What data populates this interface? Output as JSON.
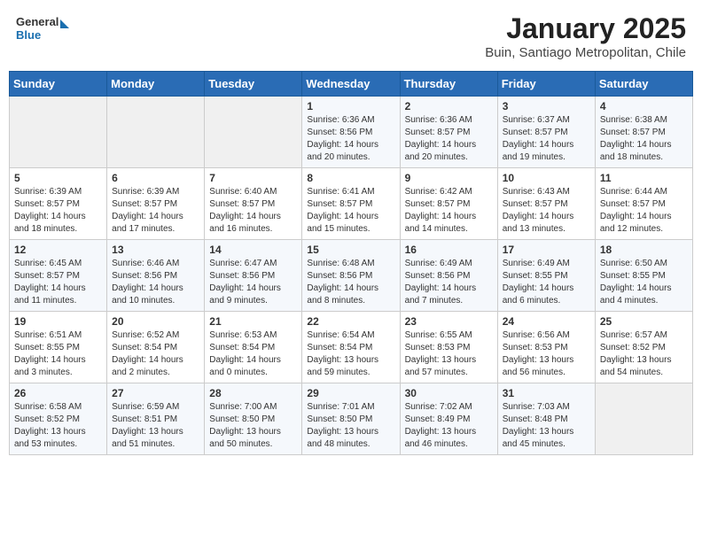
{
  "header": {
    "logo_general": "General",
    "logo_blue": "Blue",
    "month_title": "January 2025",
    "location": "Buin, Santiago Metropolitan, Chile"
  },
  "weekdays": [
    "Sunday",
    "Monday",
    "Tuesday",
    "Wednesday",
    "Thursday",
    "Friday",
    "Saturday"
  ],
  "weeks": [
    [
      {
        "day": "",
        "info": ""
      },
      {
        "day": "",
        "info": ""
      },
      {
        "day": "",
        "info": ""
      },
      {
        "day": "1",
        "info": "Sunrise: 6:36 AM\nSunset: 8:56 PM\nDaylight: 14 hours\nand 20 minutes."
      },
      {
        "day": "2",
        "info": "Sunrise: 6:36 AM\nSunset: 8:57 PM\nDaylight: 14 hours\nand 20 minutes."
      },
      {
        "day": "3",
        "info": "Sunrise: 6:37 AM\nSunset: 8:57 PM\nDaylight: 14 hours\nand 19 minutes."
      },
      {
        "day": "4",
        "info": "Sunrise: 6:38 AM\nSunset: 8:57 PM\nDaylight: 14 hours\nand 18 minutes."
      }
    ],
    [
      {
        "day": "5",
        "info": "Sunrise: 6:39 AM\nSunset: 8:57 PM\nDaylight: 14 hours\nand 18 minutes."
      },
      {
        "day": "6",
        "info": "Sunrise: 6:39 AM\nSunset: 8:57 PM\nDaylight: 14 hours\nand 17 minutes."
      },
      {
        "day": "7",
        "info": "Sunrise: 6:40 AM\nSunset: 8:57 PM\nDaylight: 14 hours\nand 16 minutes."
      },
      {
        "day": "8",
        "info": "Sunrise: 6:41 AM\nSunset: 8:57 PM\nDaylight: 14 hours\nand 15 minutes."
      },
      {
        "day": "9",
        "info": "Sunrise: 6:42 AM\nSunset: 8:57 PM\nDaylight: 14 hours\nand 14 minutes."
      },
      {
        "day": "10",
        "info": "Sunrise: 6:43 AM\nSunset: 8:57 PM\nDaylight: 14 hours\nand 13 minutes."
      },
      {
        "day": "11",
        "info": "Sunrise: 6:44 AM\nSunset: 8:57 PM\nDaylight: 14 hours\nand 12 minutes."
      }
    ],
    [
      {
        "day": "12",
        "info": "Sunrise: 6:45 AM\nSunset: 8:57 PM\nDaylight: 14 hours\nand 11 minutes."
      },
      {
        "day": "13",
        "info": "Sunrise: 6:46 AM\nSunset: 8:56 PM\nDaylight: 14 hours\nand 10 minutes."
      },
      {
        "day": "14",
        "info": "Sunrise: 6:47 AM\nSunset: 8:56 PM\nDaylight: 14 hours\nand 9 minutes."
      },
      {
        "day": "15",
        "info": "Sunrise: 6:48 AM\nSunset: 8:56 PM\nDaylight: 14 hours\nand 8 minutes."
      },
      {
        "day": "16",
        "info": "Sunrise: 6:49 AM\nSunset: 8:56 PM\nDaylight: 14 hours\nand 7 minutes."
      },
      {
        "day": "17",
        "info": "Sunrise: 6:49 AM\nSunset: 8:55 PM\nDaylight: 14 hours\nand 6 minutes."
      },
      {
        "day": "18",
        "info": "Sunrise: 6:50 AM\nSunset: 8:55 PM\nDaylight: 14 hours\nand 4 minutes."
      }
    ],
    [
      {
        "day": "19",
        "info": "Sunrise: 6:51 AM\nSunset: 8:55 PM\nDaylight: 14 hours\nand 3 minutes."
      },
      {
        "day": "20",
        "info": "Sunrise: 6:52 AM\nSunset: 8:54 PM\nDaylight: 14 hours\nand 2 minutes."
      },
      {
        "day": "21",
        "info": "Sunrise: 6:53 AM\nSunset: 8:54 PM\nDaylight: 14 hours\nand 0 minutes."
      },
      {
        "day": "22",
        "info": "Sunrise: 6:54 AM\nSunset: 8:54 PM\nDaylight: 13 hours\nand 59 minutes."
      },
      {
        "day": "23",
        "info": "Sunrise: 6:55 AM\nSunset: 8:53 PM\nDaylight: 13 hours\nand 57 minutes."
      },
      {
        "day": "24",
        "info": "Sunrise: 6:56 AM\nSunset: 8:53 PM\nDaylight: 13 hours\nand 56 minutes."
      },
      {
        "day": "25",
        "info": "Sunrise: 6:57 AM\nSunset: 8:52 PM\nDaylight: 13 hours\nand 54 minutes."
      }
    ],
    [
      {
        "day": "26",
        "info": "Sunrise: 6:58 AM\nSunset: 8:52 PM\nDaylight: 13 hours\nand 53 minutes."
      },
      {
        "day": "27",
        "info": "Sunrise: 6:59 AM\nSunset: 8:51 PM\nDaylight: 13 hours\nand 51 minutes."
      },
      {
        "day": "28",
        "info": "Sunrise: 7:00 AM\nSunset: 8:50 PM\nDaylight: 13 hours\nand 50 minutes."
      },
      {
        "day": "29",
        "info": "Sunrise: 7:01 AM\nSunset: 8:50 PM\nDaylight: 13 hours\nand 48 minutes."
      },
      {
        "day": "30",
        "info": "Sunrise: 7:02 AM\nSunset: 8:49 PM\nDaylight: 13 hours\nand 46 minutes."
      },
      {
        "day": "31",
        "info": "Sunrise: 7:03 AM\nSunset: 8:48 PM\nDaylight: 13 hours\nand 45 minutes."
      },
      {
        "day": "",
        "info": ""
      }
    ]
  ]
}
